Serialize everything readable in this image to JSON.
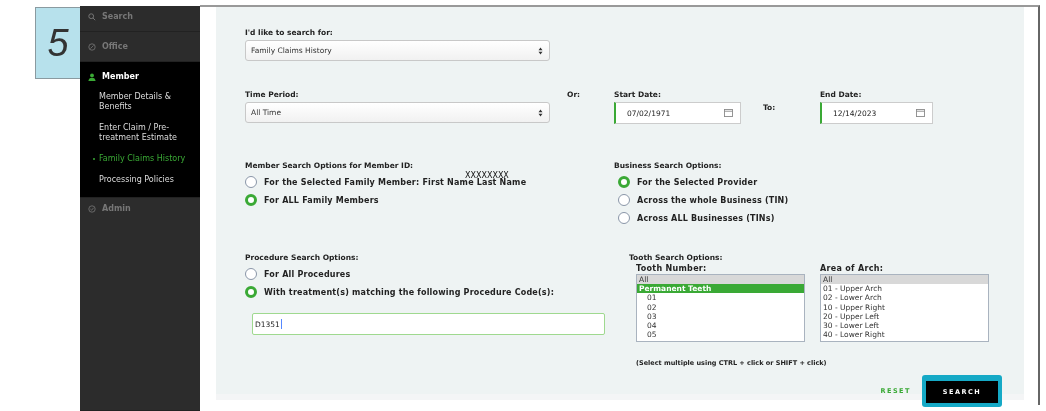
{
  "step_badge": "5",
  "sidebar": {
    "sections": [
      {
        "kind": "search",
        "label": "Search",
        "expanded": false
      },
      {
        "kind": "office",
        "label": "Office",
        "expanded": false
      },
      {
        "kind": "member",
        "label": "Member",
        "expanded": true,
        "children": [
          {
            "label": "Member Details & Benefits",
            "selected": false
          },
          {
            "label": "Enter Claim / Pre-treatment Estimate",
            "selected": false
          },
          {
            "label": "Family Claims History",
            "selected": true
          },
          {
            "label": "Processing Policies",
            "selected": false
          }
        ]
      },
      {
        "kind": "admin",
        "label": "Admin",
        "expanded": false
      }
    ]
  },
  "search_for": {
    "label": "I'd like to search for:",
    "value": "Family Claims History"
  },
  "time_period": {
    "label": "Time Period:",
    "value": "All Time"
  },
  "or_label": "Or:",
  "start_date": {
    "label": "Start Date:",
    "value": "07/02/1971"
  },
  "to_label": "To:",
  "end_date": {
    "label": "End Date:",
    "value": "12/14/2023"
  },
  "member_options": {
    "label": "Member Search Options for Member ID:",
    "member_id": "XXXXXXXX",
    "options": [
      {
        "label": "For the Selected Family Member: First Name Last Name",
        "selected": false
      },
      {
        "label": "For ALL Family Members",
        "selected": true
      }
    ]
  },
  "business_options": {
    "label": "Business Search Options:",
    "options": [
      {
        "label": "For the Selected Provider",
        "selected": true
      },
      {
        "label": "Across the whole Business (TIN)",
        "selected": false
      },
      {
        "label": "Across ALL Businesses (TINs)",
        "selected": false
      }
    ]
  },
  "procedure_options": {
    "label": "Procedure Search Options:",
    "options": [
      {
        "label": "For All Procedures",
        "selected": false
      },
      {
        "label": "With treatment(s) matching the following Procedure Code(s):",
        "selected": true
      }
    ],
    "code_value": "D1351"
  },
  "tooth_options": {
    "label": "Tooth Search Options:",
    "lists": [
      {
        "label": "Tooth Number:",
        "items": [
          {
            "label": "All",
            "selected": true,
            "active": false,
            "indented": false
          },
          {
            "label": "Permanent Teeth",
            "selected": true,
            "active": true,
            "indented": false
          },
          {
            "label": "01",
            "selected": false,
            "active": false,
            "indented": true
          },
          {
            "label": "02",
            "selected": false,
            "active": false,
            "indented": true
          },
          {
            "label": "03",
            "selected": false,
            "active": false,
            "indented": true
          },
          {
            "label": "04",
            "selected": false,
            "active": false,
            "indented": true
          },
          {
            "label": "05",
            "selected": false,
            "active": false,
            "indented": true
          }
        ]
      },
      {
        "label": "Area of Arch:",
        "items": [
          {
            "label": "All",
            "selected": true,
            "active": false,
            "indented": false
          },
          {
            "label": "01 - Upper Arch",
            "selected": false,
            "active": false,
            "indented": false
          },
          {
            "label": "02 - Lower Arch",
            "selected": false,
            "active": false,
            "indented": false
          },
          {
            "label": "10 - Upper Right",
            "selected": false,
            "active": false,
            "indented": false
          },
          {
            "label": "20 - Upper Left",
            "selected": false,
            "active": false,
            "indented": false
          },
          {
            "label": "30 - Lower Left",
            "selected": false,
            "active": false,
            "indented": false
          },
          {
            "label": "40 - Lower Right",
            "selected": false,
            "active": false,
            "indented": false
          }
        ]
      }
    ],
    "hint": "(Select multiple using CTRL + click or SHIFT + click)"
  },
  "buttons": {
    "reset": "RESET",
    "search": "SEARCH"
  }
}
